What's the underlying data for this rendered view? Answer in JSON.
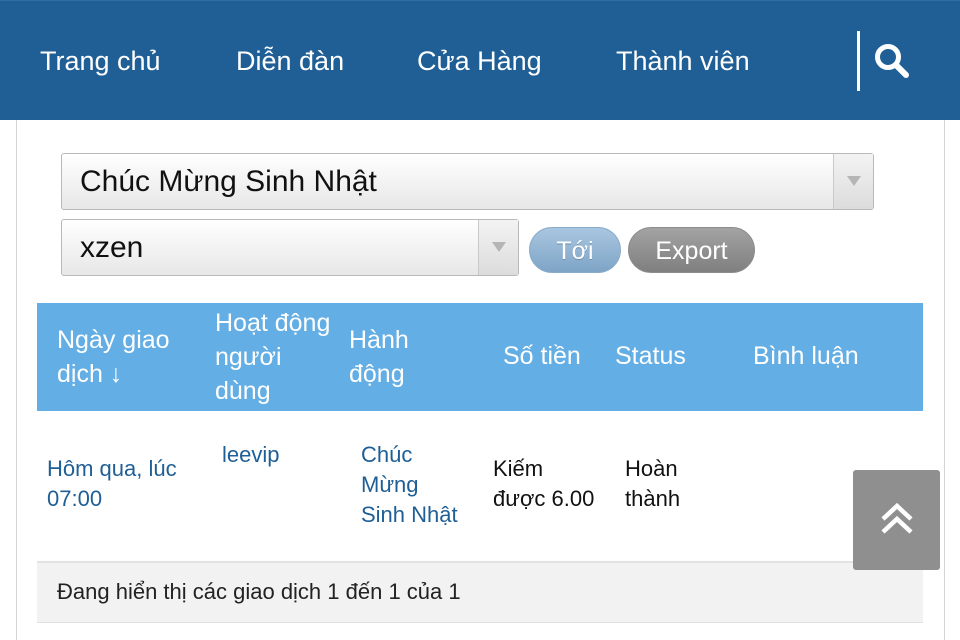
{
  "nav": {
    "items": [
      {
        "label": "Trang chủ"
      },
      {
        "label": "Diễn đàn"
      },
      {
        "label": "Cửa Hàng"
      },
      {
        "label": "Thành viên"
      }
    ],
    "search_icon": "search-icon",
    "background_color": "#1f5f95"
  },
  "filters": {
    "transaction_type": "Chúc Mừng Sinh Nhật",
    "user": "xzen",
    "go_label": "Tới",
    "export_label": "Export"
  },
  "table": {
    "header_color": "#63aee4",
    "columns": [
      {
        "line1": "Ngày giao",
        "line2": "dịch ↓",
        "line3": ""
      },
      {
        "line1": "Hoạt động",
        "line2": "người",
        "line3": "dùng"
      },
      {
        "line1": "Hành",
        "line2": "động",
        "line3": ""
      },
      {
        "line1": "Số tiền",
        "line2": "",
        "line3": ""
      },
      {
        "line1": "Status",
        "line2": "",
        "line3": ""
      },
      {
        "line1": "Bình luận",
        "line2": "",
        "line3": ""
      }
    ],
    "rows": [
      {
        "date_line1": "Hôm qua, lúc",
        "date_line2": "07:00",
        "user": "leevip",
        "action_line1": "Chúc",
        "action_line2": "Mừng",
        "action_line3": "Sinh Nhật",
        "amount_line1": "Kiếm",
        "amount_line2": "được 6.00",
        "status_line1": "Hoàn",
        "status_line2": "thành",
        "comment": ""
      }
    ],
    "footer": "Đang hiển thị các giao dịch 1 đến 1 của 1"
  },
  "back_to_top_icon": "double-chevron-up-icon"
}
